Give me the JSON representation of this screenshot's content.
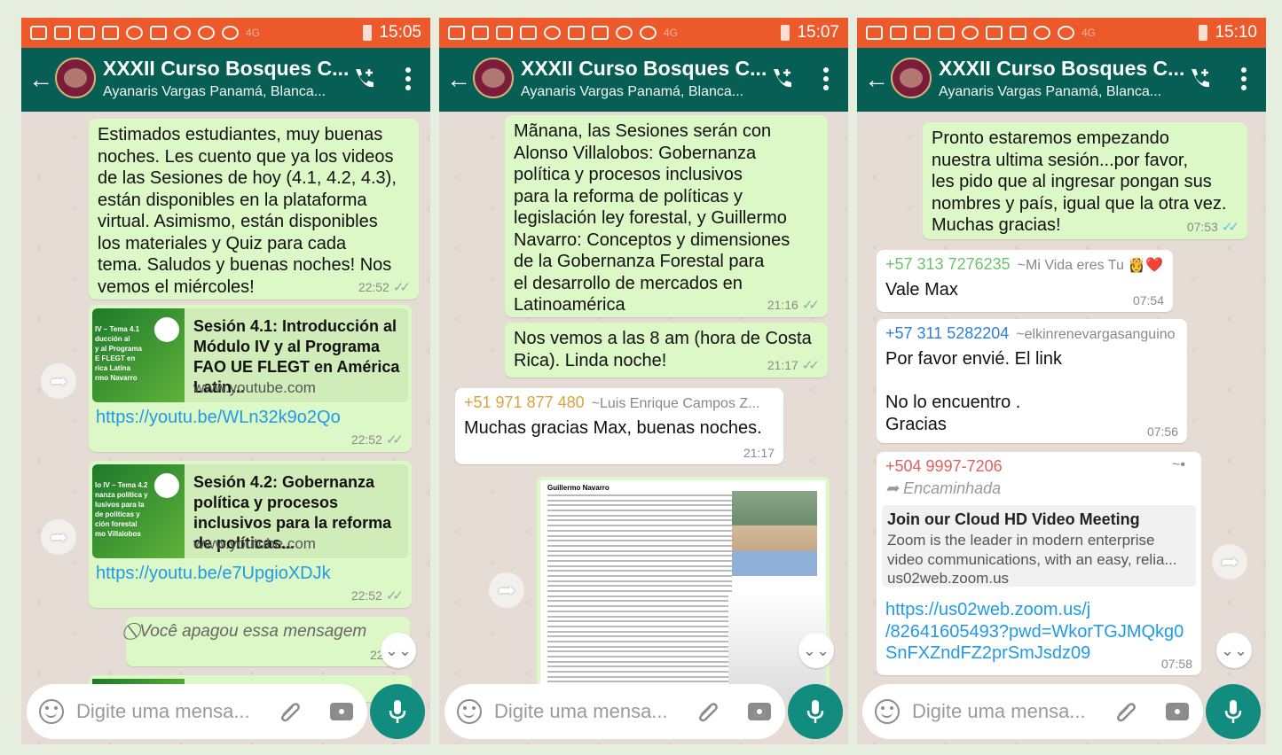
{
  "colors": {
    "status_bar": "#ec5a2b",
    "header": "#075e54",
    "outgoing": "#dcf8c6",
    "incoming": "#ffffff",
    "mic": "#128c7e",
    "link": "#1f9ae6"
  },
  "phones": [
    {
      "time": "15:05",
      "net": "4G",
      "title": "XXXII Curso Bosques C...",
      "subtitle": "Ayanaris Vargas Panamá, Blanca...",
      "placeholder": "Digite uma mensa...",
      "messages": [
        {
          "text": "Estimados estudiantes, muy buenas\nnoches. Les cuento que ya los videos\nde las Sesiones de hoy (4.1, 4.2, 4.3),\nestán disponibles en la plataforma\nvirtual. Asimismo, están disponibles\nlos materiales y Quiz para cada\ntema. Saludos y buenas noches! Nos\nvemos el miércoles!",
          "time": "22:52"
        },
        {
          "thumb": "IV – Tema 4.1\nducción al\ny al Programa\nE FLEGT en\nrica Latina\nrmo Navarro",
          "title": "Sesión 4.1: Introducción al Módulo IV y al Programa FAO UE FLEGT en América Latin...",
          "host": "www.youtube.com",
          "link": "https://youtu.be/WLn32k9o2Qo",
          "time": "22:52"
        },
        {
          "thumb": "lo IV – Tema 4.2\nnanza política y\nlusivos para la\nde políticas y\nción forestal\nmo Villalobos",
          "title": "Sesión 4.2: Gobernanza política y procesos inclusivos para la reforma de políticas...",
          "host": "www.youtube.com",
          "link": "https://youtu.be/e7UpgioXDJk",
          "time": "22:52"
        },
        {
          "text": "Você apagou essa mensagem",
          "time": "22:53"
        }
      ]
    },
    {
      "time": "15:07",
      "net": "4G",
      "title": "XXXII Curso Bosques C...",
      "subtitle": "Ayanaris Vargas Panamá, Blanca...",
      "placeholder": "Digite uma mensa...",
      "messages": [
        {
          "text": "Mãnana, las Sesiones serán con\nAlonso Villalobos: Gobernanza\npolítica y procesos inclusivos\npara la reforma de políticas y\nlegislación ley forestal, y Guillermo\nNavarro: Conceptos y dimensiones\nde la Gobernanza Forestal para\nel desarrollo de mercados en\nLatinoamérica",
          "time": "21:16"
        },
        {
          "text": "Nos vemos a las 8 am (hora de Costa\nRica). Linda noche!",
          "time": "21:17"
        },
        {
          "number": "+51 971 877 480",
          "alias": "~Luis Enrique Campos Z...",
          "text": "Muchas gracias Max, buenas noches.",
          "time": "21:17"
        },
        {
          "doc_title": "Guillermo Navarro"
        }
      ]
    },
    {
      "time": "15:10",
      "net": "4G",
      "title": "XXXII Curso Bosques C...",
      "subtitle": "Ayanaris Vargas Panamá, Blanca...",
      "placeholder": "Digite uma mensa...",
      "messages": [
        {
          "text": "Pronto estaremos empezando\nnuestra ultima sesión...por favor,\nles pido que al ingresar pongan sus\nnombres y país, igual que la otra vez.\nMuchas gracias!",
          "time": "07:53"
        },
        {
          "number": "+57 313 7276235",
          "alias": "~Mi Vida eres Tu 👸❤️",
          "text": "Vale Max",
          "time": "07:54"
        },
        {
          "number": "+57 311 5282204",
          "alias": "~elkinrenevargasanguino",
          "text": "Por favor envié. El link\n\nNo lo encuentro .\nGracias",
          "time": "07:56"
        },
        {
          "number": "+504 9997-7206",
          "alias": "~•",
          "forwarded": "Encaminhada",
          "preview_title": "Join our Cloud HD Video Meeting",
          "preview_desc": "Zoom is the leader in modern enterprise video communications, with an easy, relia...",
          "preview_host": "us02web.zoom.us",
          "link": "https://us02web.zoom.us/j\n/82641605493?pwd=WkorTGJMQkg0\nSnFXZndFZ2prSmJsdz09",
          "time": "07:58"
        }
      ]
    }
  ]
}
